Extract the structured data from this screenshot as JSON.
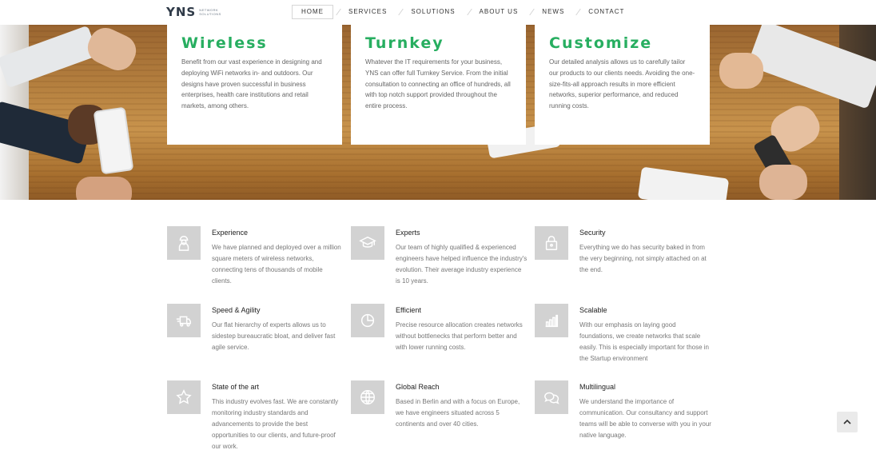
{
  "brand": {
    "logo_text": "YNS",
    "logo_subtitle": "NETWORK SOLUTIONS",
    "accent_color": "#27ae60"
  },
  "nav": {
    "items": [
      {
        "label": "HOME",
        "active": true
      },
      {
        "label": "SERVICES",
        "active": false
      },
      {
        "label": "SOLUTIONS",
        "active": false
      },
      {
        "label": "ABOUT US",
        "active": false
      },
      {
        "label": "NEWS",
        "active": false
      },
      {
        "label": "CONTACT",
        "active": false
      }
    ]
  },
  "hero": {
    "cards": [
      {
        "title": "Wireless",
        "text": "Benefit from our vast experience in designing and deploying WiFi networks in- and outdoors. Our designs have proven successful in business enterprises, health care institutions and retail markets, among others."
      },
      {
        "title": "Turnkey",
        "text": "Whatever the IT requirements for your business, YNS can offer full Turnkey Service. From the initial consultation to connecting an office of hundreds, all with top notch support provided throughout the entire process."
      },
      {
        "title": "Customize",
        "text": "Our detailed analysis allows us to carefully tailor our products to our clients needs. Avoiding the one-size-fits-all approach results in more efficient networks, superior performance, and reduced running costs."
      }
    ]
  },
  "features": [
    {
      "icon": "engineer-icon",
      "title": "Experience",
      "text": "We have planned and deployed over a million square meters of wireless networks, connecting tens of thousands of mobile clients."
    },
    {
      "icon": "graduation-cap-icon",
      "title": "Experts",
      "text": "Our team of highly qualified & experienced engineers have helped influence the industry's evolution. Their average industry experience is 10 years."
    },
    {
      "icon": "lock-icon",
      "title": "Security",
      "text": "Everything we do has security baked in from the very beginning, not simply attached on at the end."
    },
    {
      "icon": "delivery-truck-icon",
      "title": "Speed & Agility",
      "text": "Our flat hierarchy of experts allows us to sidestep bureaucratic bloat, and deliver fast agile service."
    },
    {
      "icon": "pie-chart-icon",
      "title": "Efficient",
      "text": "Precise resource allocation creates networks without bottlenecks that perform better and with lower running costs."
    },
    {
      "icon": "bar-chart-icon",
      "title": "Scalable",
      "text": "With our emphasis on laying good foundations, we create networks that scale easily. This is especially important for those in the Startup environment"
    },
    {
      "icon": "star-icon",
      "title": "State of the art",
      "text": "This industry evolves fast. We are constantly monitoring industry standards and advancements to provide the best opportunities to our clients, and future-proof our work."
    },
    {
      "icon": "globe-icon",
      "title": "Global Reach",
      "text": "Based in Berlin and with a focus on Europe, we have engineers situated across 5 continents and over 40 cities."
    },
    {
      "icon": "chat-bubbles-icon",
      "title": "Multilingual",
      "text": "We understand the importance of communication. Our consultancy and support teams will be able to converse with you in your native language."
    }
  ],
  "scroll_top": {
    "icon": "chevron-up-icon"
  }
}
